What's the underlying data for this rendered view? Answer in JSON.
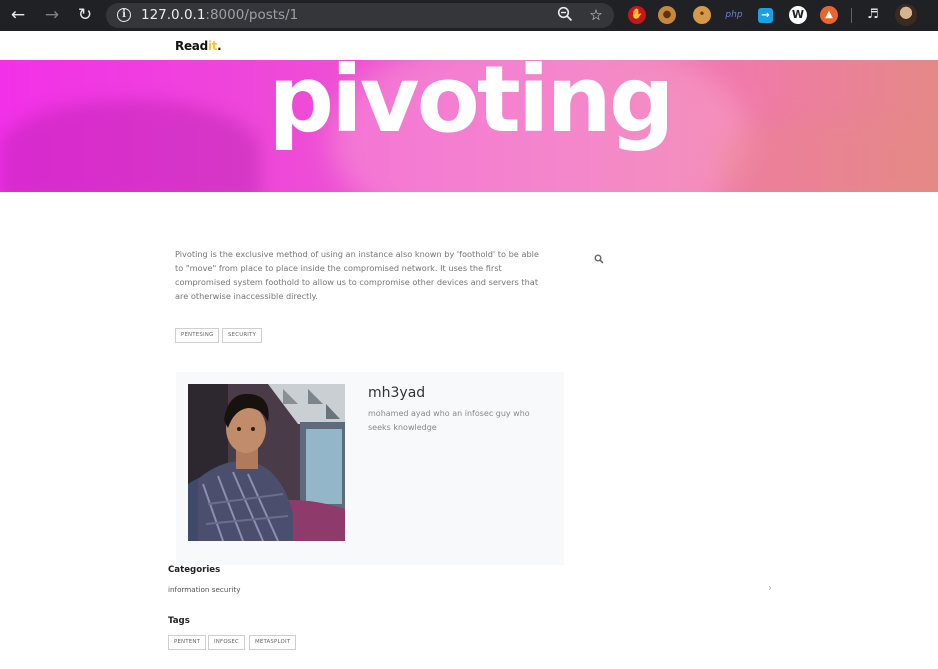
{
  "browser": {
    "url_host": "127.0.0.1",
    "url_rest": ":8000/posts/1",
    "icons": [
      "back-icon",
      "forward-icon",
      "reload-icon",
      "info-icon",
      "zoom-icon",
      "star-icon"
    ],
    "extensions": [
      "ublock-icon",
      "cookie-icon",
      "cookie-editor-icon",
      "php-icon",
      "bookmark-icon",
      "wappalyzer-icon",
      "hackbar-icon",
      "media-icon",
      "profile-avatar"
    ],
    "ext_php_label": "php",
    "ext_w_label": "W"
  },
  "site": {
    "logo_main": "Read",
    "logo_accent": "it",
    "logo_dot": "."
  },
  "post": {
    "title": "pivoting",
    "body": "Pivoting is the exclusive method of using an instance also known by 'foothold' to be able to \"move\" from place to place inside the compromised network. It uses the first compromised system foothold to allow us to compromise other devices and servers that are otherwise inaccessible directly.",
    "tags": [
      "PENTESING",
      "SECURITY"
    ]
  },
  "author": {
    "name": "mh3yad",
    "bio": "mohamed ayad who an infosec guy who seeks knowledge"
  },
  "sidebar": {
    "categories_heading": "Categories",
    "categories": [
      "information security"
    ],
    "tags_heading": "Tags",
    "tags": [
      "PENTENT",
      "INFOSEC",
      "METASPLOIT"
    ]
  },
  "colors": {
    "hero_start": "#f230e8",
    "hero_end": "#e58987",
    "logo_accent": "#fbc531",
    "chrome_bg": "#202124",
    "author_box_bg": "#f8f9fa"
  }
}
